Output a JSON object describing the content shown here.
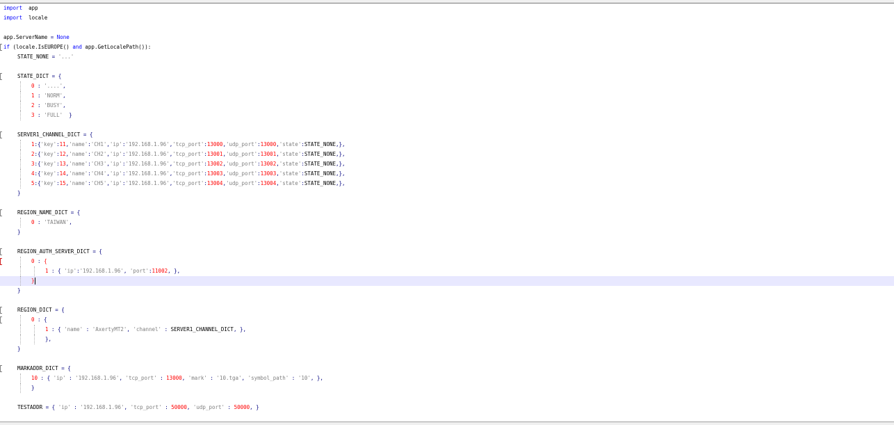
{
  "editor": {
    "current_line": 28,
    "lines": [
      {
        "indent": 0,
        "fold": false,
        "tokens": [
          [
            "kw",
            "import"
          ],
          [
            "",
            "  app"
          ]
        ]
      },
      {
        "indent": 0,
        "fold": false,
        "tokens": [
          [
            "kw",
            "import"
          ],
          [
            "",
            "  locale"
          ]
        ]
      },
      {
        "indent": 0,
        "fold": false,
        "tokens": []
      },
      {
        "indent": 0,
        "fold": false,
        "tokens": [
          [
            "",
            "app.ServerName "
          ],
          [
            "op",
            "="
          ],
          [
            "kw",
            " None"
          ]
        ]
      },
      {
        "indent": 0,
        "fold": true,
        "tokens": [
          [
            "kw",
            "if"
          ],
          [
            "",
            " (locale.IsEUROPE() "
          ],
          [
            "kw",
            "and"
          ],
          [
            "",
            " app.GetLocalePath()):"
          ]
        ]
      },
      {
        "indent": 1,
        "fold": false,
        "tokens": [
          [
            "",
            "STATE_NONE "
          ],
          [
            "op",
            "="
          ],
          [
            "str",
            " '...'"
          ]
        ]
      },
      {
        "indent": 1,
        "fold": false,
        "tokens": []
      },
      {
        "indent": 1,
        "fold": true,
        "tokens": [
          [
            "",
            "STATE_DICT "
          ],
          [
            "op",
            "="
          ],
          [
            "op",
            " {"
          ]
        ]
      },
      {
        "indent": 2,
        "fold": false,
        "tokens": [
          [
            "num",
            "0"
          ],
          [
            "op",
            " : "
          ],
          [
            "str",
            "'....'"
          ],
          [
            "op",
            ","
          ]
        ]
      },
      {
        "indent": 2,
        "fold": false,
        "tokens": [
          [
            "num",
            "1"
          ],
          [
            "op",
            " : "
          ],
          [
            "str",
            "'NORM'"
          ],
          [
            "op",
            ","
          ]
        ]
      },
      {
        "indent": 2,
        "fold": false,
        "tokens": [
          [
            "num",
            "2"
          ],
          [
            "op",
            " : "
          ],
          [
            "str",
            "'BUSY'"
          ],
          [
            "op",
            ","
          ]
        ]
      },
      {
        "indent": 2,
        "fold": false,
        "tokens": [
          [
            "num",
            "3"
          ],
          [
            "op",
            " : "
          ],
          [
            "str",
            "'FULL'"
          ],
          [
            "op",
            "  }"
          ]
        ]
      },
      {
        "indent": 1,
        "fold": false,
        "tokens": []
      },
      {
        "indent": 1,
        "fold": true,
        "tokens": [
          [
            "",
            "SERVER1_CHANNEL_DICT "
          ],
          [
            "op",
            "="
          ],
          [
            "op",
            " {"
          ]
        ]
      },
      {
        "indent": 2,
        "fold": false,
        "tokens": [
          [
            "num",
            "1"
          ],
          [
            "op",
            ":{"
          ],
          [
            "str",
            "'key'"
          ],
          [
            "op",
            ":"
          ],
          [
            "num",
            "11"
          ],
          [
            "op",
            ","
          ],
          [
            "str",
            "'name'"
          ],
          [
            "op",
            ":"
          ],
          [
            "str",
            "'CH1'"
          ],
          [
            "op",
            ","
          ],
          [
            "str",
            "'ip'"
          ],
          [
            "op",
            ":"
          ],
          [
            "str",
            "'192.168.1.96'"
          ],
          [
            "op",
            ","
          ],
          [
            "str",
            "'tcp_port'"
          ],
          [
            "op",
            ":"
          ],
          [
            "num",
            "13000"
          ],
          [
            "op",
            ","
          ],
          [
            "str",
            "'udp_port'"
          ],
          [
            "op",
            ":"
          ],
          [
            "num",
            "13000"
          ],
          [
            "op",
            ","
          ],
          [
            "str",
            "'state'"
          ],
          [
            "op",
            ":"
          ],
          [
            "",
            "STATE_NONE"
          ],
          [
            "op",
            ",},"
          ]
        ]
      },
      {
        "indent": 2,
        "fold": false,
        "tokens": [
          [
            "num",
            "2"
          ],
          [
            "op",
            ":{"
          ],
          [
            "str",
            "'key'"
          ],
          [
            "op",
            ":"
          ],
          [
            "num",
            "12"
          ],
          [
            "op",
            ","
          ],
          [
            "str",
            "'name'"
          ],
          [
            "op",
            ":"
          ],
          [
            "str",
            "'CH2'"
          ],
          [
            "op",
            ","
          ],
          [
            "str",
            "'ip'"
          ],
          [
            "op",
            ":"
          ],
          [
            "str",
            "'192.168.1.96'"
          ],
          [
            "op",
            ","
          ],
          [
            "str",
            "'tcp_port'"
          ],
          [
            "op",
            ":"
          ],
          [
            "num",
            "13001"
          ],
          [
            "op",
            ","
          ],
          [
            "str",
            "'udp_port'"
          ],
          [
            "op",
            ":"
          ],
          [
            "num",
            "13001"
          ],
          [
            "op",
            ","
          ],
          [
            "str",
            "'state'"
          ],
          [
            "op",
            ":"
          ],
          [
            "",
            "STATE_NONE"
          ],
          [
            "op",
            ",},"
          ]
        ]
      },
      {
        "indent": 2,
        "fold": false,
        "tokens": [
          [
            "num",
            "3"
          ],
          [
            "op",
            ":{"
          ],
          [
            "str",
            "'key'"
          ],
          [
            "op",
            ":"
          ],
          [
            "num",
            "13"
          ],
          [
            "op",
            ","
          ],
          [
            "str",
            "'name'"
          ],
          [
            "op",
            ":"
          ],
          [
            "str",
            "'CH3'"
          ],
          [
            "op",
            ","
          ],
          [
            "str",
            "'ip'"
          ],
          [
            "op",
            ":"
          ],
          [
            "str",
            "'192.168.1.96'"
          ],
          [
            "op",
            ","
          ],
          [
            "str",
            "'tcp_port'"
          ],
          [
            "op",
            ":"
          ],
          [
            "num",
            "13002"
          ],
          [
            "op",
            ","
          ],
          [
            "str",
            "'udp_port'"
          ],
          [
            "op",
            ":"
          ],
          [
            "num",
            "13002"
          ],
          [
            "op",
            ","
          ],
          [
            "str",
            "'state'"
          ],
          [
            "op",
            ":"
          ],
          [
            "",
            "STATE_NONE"
          ],
          [
            "op",
            ",},"
          ]
        ]
      },
      {
        "indent": 2,
        "fold": false,
        "tokens": [
          [
            "num",
            "4"
          ],
          [
            "op",
            ":{"
          ],
          [
            "str",
            "'key'"
          ],
          [
            "op",
            ":"
          ],
          [
            "num",
            "14"
          ],
          [
            "op",
            ","
          ],
          [
            "str",
            "'name'"
          ],
          [
            "op",
            ":"
          ],
          [
            "str",
            "'CH4'"
          ],
          [
            "op",
            ","
          ],
          [
            "str",
            "'ip'"
          ],
          [
            "op",
            ":"
          ],
          [
            "str",
            "'192.168.1.96'"
          ],
          [
            "op",
            ","
          ],
          [
            "str",
            "'tcp_port'"
          ],
          [
            "op",
            ":"
          ],
          [
            "num",
            "13003"
          ],
          [
            "op",
            ","
          ],
          [
            "str",
            "'udp_port'"
          ],
          [
            "op",
            ":"
          ],
          [
            "num",
            "13003"
          ],
          [
            "op",
            ","
          ],
          [
            "str",
            "'state'"
          ],
          [
            "op",
            ":"
          ],
          [
            "",
            "STATE_NONE"
          ],
          [
            "op",
            ",},"
          ]
        ]
      },
      {
        "indent": 2,
        "fold": false,
        "tokens": [
          [
            "num",
            "5"
          ],
          [
            "op",
            ":{"
          ],
          [
            "str",
            "'key'"
          ],
          [
            "op",
            ":"
          ],
          [
            "num",
            "15"
          ],
          [
            "op",
            ","
          ],
          [
            "str",
            "'name'"
          ],
          [
            "op",
            ":"
          ],
          [
            "str",
            "'CH5'"
          ],
          [
            "op",
            ","
          ],
          [
            "str",
            "'ip'"
          ],
          [
            "op",
            ":"
          ],
          [
            "str",
            "'192.168.1.96'"
          ],
          [
            "op",
            ","
          ],
          [
            "str",
            "'tcp_port'"
          ],
          [
            "op",
            ":"
          ],
          [
            "num",
            "13004"
          ],
          [
            "op",
            ","
          ],
          [
            "str",
            "'udp_port'"
          ],
          [
            "op",
            ":"
          ],
          [
            "num",
            "13004"
          ],
          [
            "op",
            ","
          ],
          [
            "str",
            "'state'"
          ],
          [
            "op",
            ":"
          ],
          [
            "",
            "STATE_NONE"
          ],
          [
            "op",
            ",},"
          ]
        ]
      },
      {
        "indent": 1,
        "fold": false,
        "tokens": [
          [
            "op",
            "}"
          ]
        ]
      },
      {
        "indent": 1,
        "fold": false,
        "tokens": []
      },
      {
        "indent": 1,
        "fold": true,
        "tokens": [
          [
            "",
            "REGION_NAME_DICT "
          ],
          [
            "op",
            "="
          ],
          [
            "op",
            " {"
          ]
        ]
      },
      {
        "indent": 2,
        "fold": false,
        "tokens": [
          [
            "num",
            "0"
          ],
          [
            "op",
            " : "
          ],
          [
            "str",
            "'TAIWAN'"
          ],
          [
            "op",
            ","
          ]
        ]
      },
      {
        "indent": 1,
        "fold": false,
        "tokens": [
          [
            "op",
            "}"
          ]
        ]
      },
      {
        "indent": 1,
        "fold": false,
        "tokens": []
      },
      {
        "indent": 1,
        "fold": true,
        "tokens": [
          [
            "",
            "REGION_AUTH_SERVER_DICT "
          ],
          [
            "op",
            "="
          ],
          [
            "op",
            " {"
          ]
        ]
      },
      {
        "indent": 2,
        "fold": true,
        "red": true,
        "tokens": [
          [
            "num",
            "0"
          ],
          [
            "op",
            " : "
          ],
          [
            "num",
            "{"
          ]
        ]
      },
      {
        "indent": 3,
        "fold": false,
        "tokens": [
          [
            "num",
            "1"
          ],
          [
            "op",
            " : { "
          ],
          [
            "str",
            "'ip'"
          ],
          [
            "op",
            ":"
          ],
          [
            "str",
            "'192.168.1.96'"
          ],
          [
            "op",
            ", "
          ],
          [
            "str",
            "'port'"
          ],
          [
            "op",
            ":"
          ],
          [
            "num",
            "11002"
          ],
          [
            "op",
            ", },"
          ]
        ]
      },
      {
        "indent": 2,
        "fold": false,
        "caret": true,
        "tokens": [
          [
            "num",
            "}"
          ]
        ]
      },
      {
        "indent": 1,
        "fold": false,
        "tokens": [
          [
            "op",
            "}"
          ]
        ]
      },
      {
        "indent": 1,
        "fold": false,
        "tokens": []
      },
      {
        "indent": 1,
        "fold": true,
        "tokens": [
          [
            "",
            "REGION_DICT "
          ],
          [
            "op",
            "="
          ],
          [
            "op",
            " {"
          ]
        ]
      },
      {
        "indent": 2,
        "fold": true,
        "tokens": [
          [
            "num",
            "0"
          ],
          [
            "op",
            " : {"
          ]
        ]
      },
      {
        "indent": 3,
        "fold": false,
        "tokens": [
          [
            "num",
            "1"
          ],
          [
            "op",
            " : { "
          ],
          [
            "str",
            "'name'"
          ],
          [
            "op",
            " : "
          ],
          [
            "str",
            "'AxertyMT2'"
          ],
          [
            "op",
            ", "
          ],
          [
            "str",
            "'channel'"
          ],
          [
            "op",
            " : "
          ],
          [
            "",
            "SERVER1_CHANNEL_DICT"
          ],
          [
            "op",
            ", },"
          ]
        ]
      },
      {
        "indent": 3,
        "fold": false,
        "tokens": [
          [
            "op",
            "},"
          ]
        ]
      },
      {
        "indent": 1,
        "fold": false,
        "tokens": [
          [
            "op",
            "}"
          ]
        ]
      },
      {
        "indent": 1,
        "fold": false,
        "tokens": []
      },
      {
        "indent": 1,
        "fold": true,
        "tokens": [
          [
            "",
            "MARKADDR_DICT "
          ],
          [
            "op",
            "="
          ],
          [
            "op",
            " {"
          ]
        ]
      },
      {
        "indent": 2,
        "fold": false,
        "tokens": [
          [
            "num",
            "10"
          ],
          [
            "op",
            " : { "
          ],
          [
            "str",
            "'ip'"
          ],
          [
            "op",
            " : "
          ],
          [
            "str",
            "'192.168.1.96'"
          ],
          [
            "op",
            ", "
          ],
          [
            "str",
            "'tcp_port'"
          ],
          [
            "op",
            " : "
          ],
          [
            "num",
            "13000"
          ],
          [
            "op",
            ", "
          ],
          [
            "str",
            "'mark'"
          ],
          [
            "op",
            " : "
          ],
          [
            "str",
            "'10.tga'"
          ],
          [
            "op",
            ", "
          ],
          [
            "str",
            "'symbol_path'"
          ],
          [
            "op",
            " : "
          ],
          [
            "str",
            "'10'"
          ],
          [
            "op",
            ", },"
          ]
        ]
      },
      {
        "indent": 2,
        "fold": false,
        "tokens": [
          [
            "op",
            "}"
          ]
        ]
      },
      {
        "indent": 1,
        "fold": false,
        "tokens": []
      },
      {
        "indent": 1,
        "fold": false,
        "tokens": [
          [
            "",
            "TESTADDR "
          ],
          [
            "op",
            "="
          ],
          [
            "op",
            " { "
          ],
          [
            "str",
            "'ip'"
          ],
          [
            "op",
            " : "
          ],
          [
            "str",
            "'192.168.1.96'"
          ],
          [
            "op",
            ", "
          ],
          [
            "str",
            "'tcp_port'"
          ],
          [
            "op",
            " : "
          ],
          [
            "num",
            "50000"
          ],
          [
            "op",
            ", "
          ],
          [
            "str",
            "'udp_port'"
          ],
          [
            "op",
            " : "
          ],
          [
            "num",
            "50000"
          ],
          [
            "op",
            ", }"
          ]
        ]
      }
    ]
  }
}
